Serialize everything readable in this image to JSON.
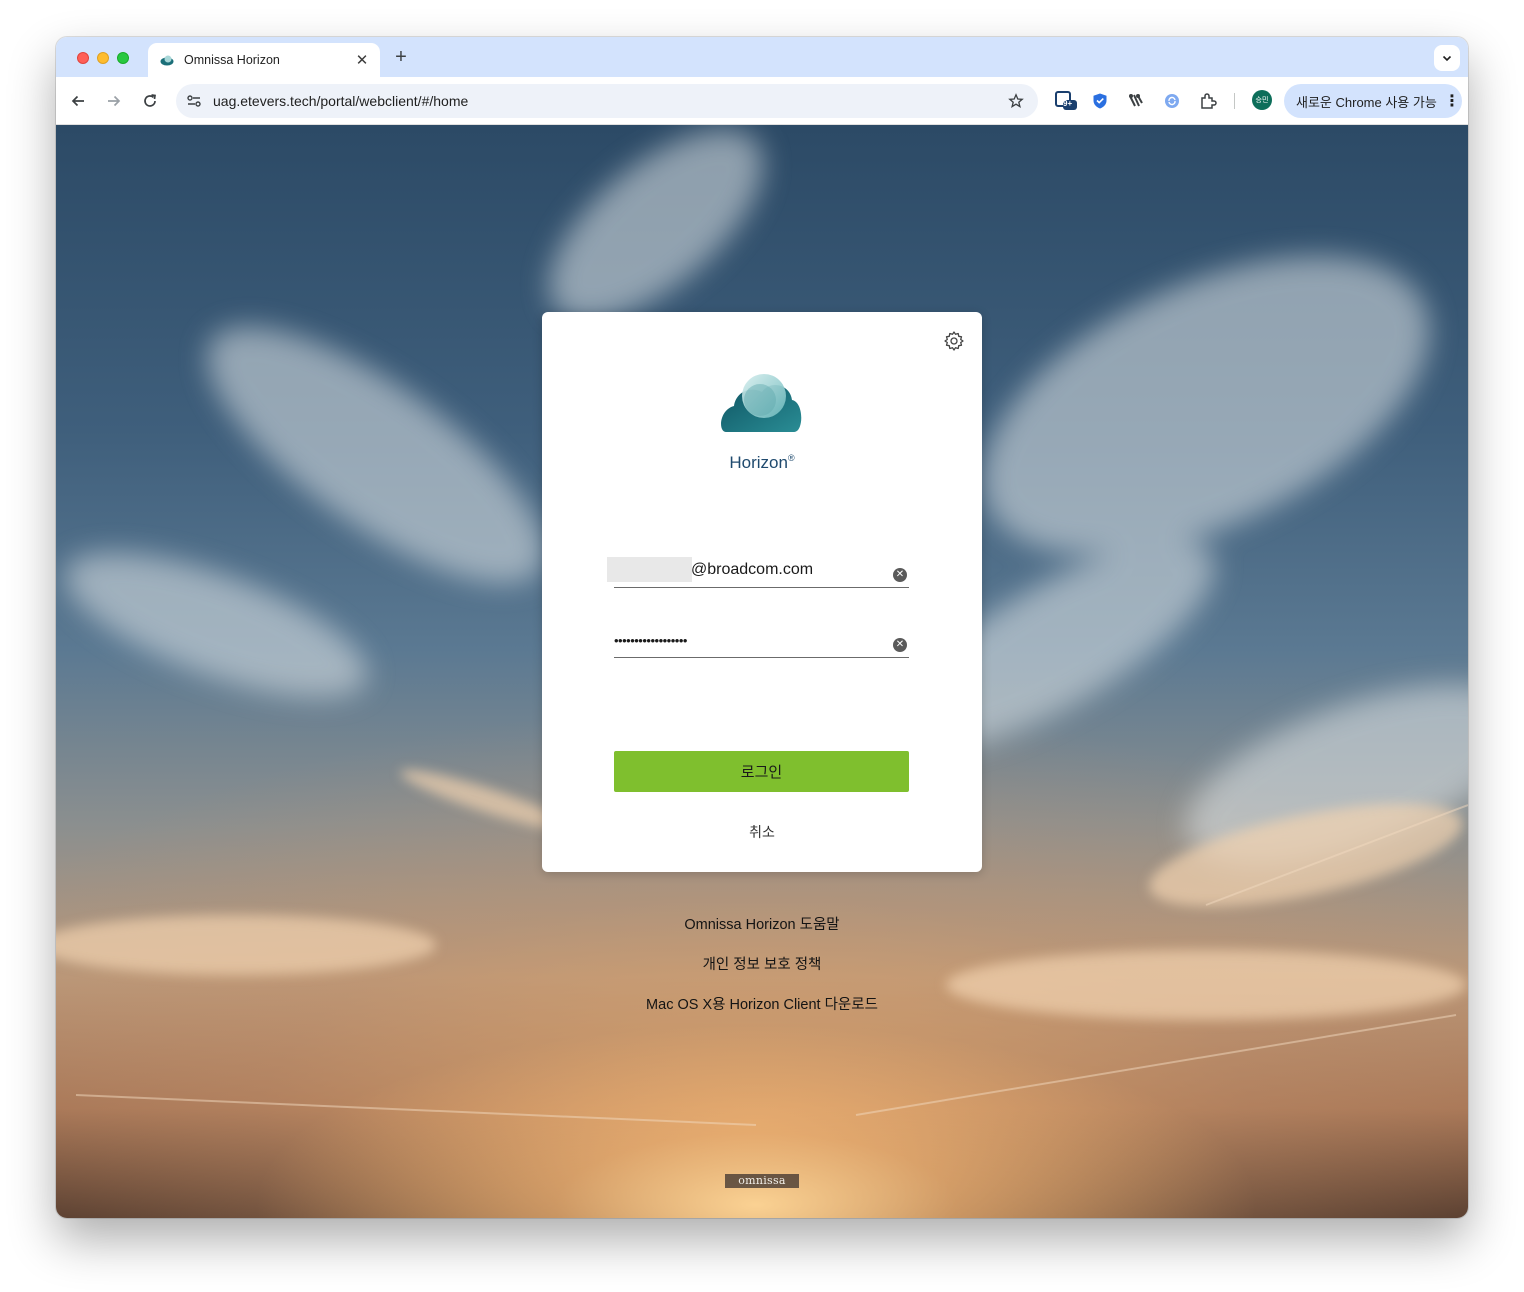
{
  "browser": {
    "tab_title": "Omnissa Horizon",
    "new_tab_label": "+",
    "url": "uag.etevers.tech/portal/webclient/#/home",
    "profile_initials": "승민",
    "chrome_update_label": "새로운 Chrome 사용 가능",
    "extension_badge": "9+"
  },
  "login": {
    "brand_name": "Horizon",
    "brand_mark": "®",
    "username_suffix": "@broadcom.com",
    "password_mask": "••••••••••••••••••",
    "login_button": "로그인",
    "cancel_link": "취소"
  },
  "footer_links": {
    "help": "Omnissa Horizon 도움말",
    "privacy": "개인 정보 보호 정책",
    "download": "Mac OS X용 Horizon Client 다운로드"
  },
  "footer_logo_text": "omnissa",
  "colors": {
    "login_button": "#7fbf2e",
    "brand_text": "#1f4a6e",
    "tabstrip": "#d3e3fd"
  }
}
